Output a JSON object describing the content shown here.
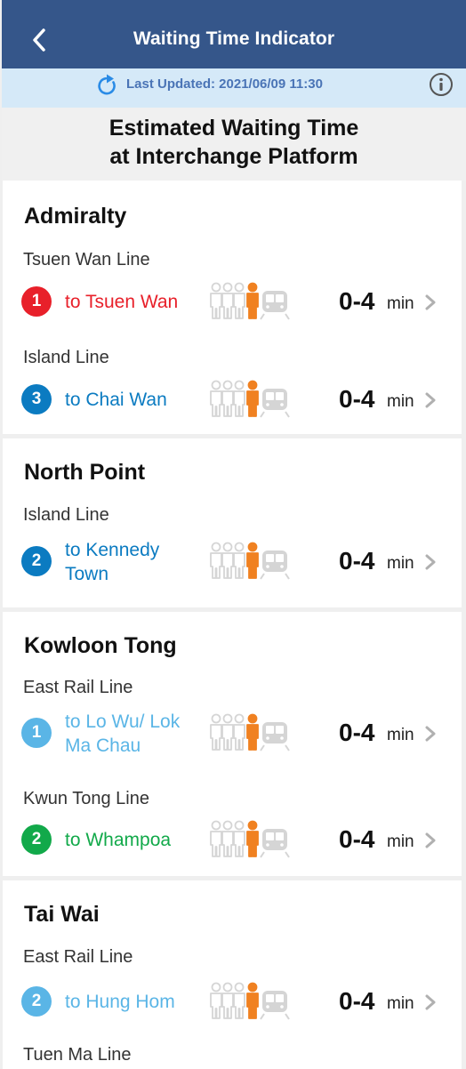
{
  "header": {
    "title": "Waiting Time Indicator",
    "back_icon": "chevron-left-icon"
  },
  "status": {
    "last_updated": "Last Updated: 2021/06/09 11:30",
    "refresh_icon": "refresh-icon",
    "info_icon": "info-icon"
  },
  "heading": {
    "line1": "Estimated Waiting Time",
    "line2": "at Interchange Platform"
  },
  "colors": {
    "header_bg": "#35568a",
    "status_bg": "#d5e9f8",
    "tsuen_wan_line": "#e8202a",
    "island_line": "#0b7bc1",
    "east_rail_line": "#5ab5e6",
    "kwun_tong_line": "#12a94a",
    "crowd_active": "#f08121",
    "crowd_inactive": "#d5d5d5"
  },
  "stations": [
    {
      "name": "Admiralty",
      "lines": [
        {
          "line": "Tsuen Wan Line",
          "platform": "1",
          "destination": "to Tsuen Wan",
          "color": "#e8202a",
          "crowd_level": "4 of 4 people (current position)",
          "wait": "0-4",
          "unit": "min"
        },
        {
          "line": "Island Line",
          "platform": "3",
          "destination": "to Chai Wan",
          "color": "#0b7bc1",
          "crowd_level": "4 of 4 people (current position)",
          "wait": "0-4",
          "unit": "min"
        }
      ]
    },
    {
      "name": "North Point",
      "lines": [
        {
          "line": "Island Line",
          "platform": "2",
          "destination": "to Kennedy Town",
          "color": "#0b7bc1",
          "crowd_level": "4 of 4 people (current position)",
          "wait": "0-4",
          "unit": "min"
        }
      ]
    },
    {
      "name": "Kowloon Tong",
      "lines": [
        {
          "line": "East Rail Line",
          "platform": "1",
          "destination": "to Lo Wu/ Lok Ma Chau",
          "color": "#5ab5e6",
          "crowd_level": "4 of 4 people (current position)",
          "wait": "0-4",
          "unit": "min"
        },
        {
          "line": "Kwun Tong Line",
          "platform": "2",
          "destination": "to Whampoa",
          "color": "#12a94a",
          "crowd_level": "4 of 4 people (current position)",
          "wait": "0-4",
          "unit": "min"
        }
      ]
    },
    {
      "name": "Tai Wai",
      "lines": [
        {
          "line": "East Rail Line",
          "platform": "2",
          "destination": "to Hung Hom",
          "color": "#5ab5e6",
          "crowd_level": "4 of 4 people (current position)",
          "wait": "0-4",
          "unit": "min"
        },
        {
          "line": "Tuen Ma Line"
        }
      ]
    }
  ]
}
